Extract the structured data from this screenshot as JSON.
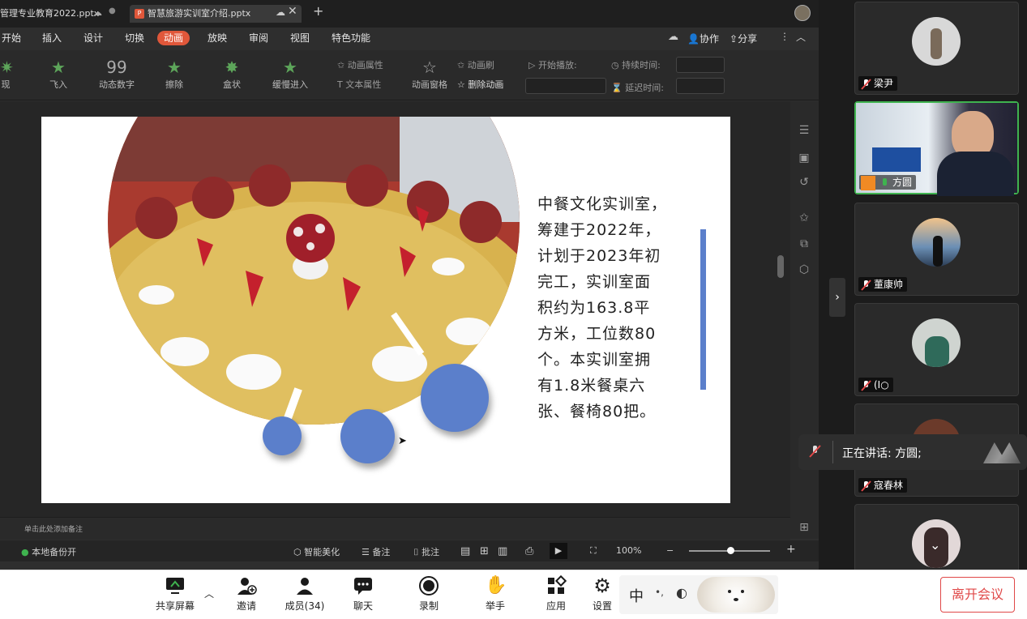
{
  "ppt": {
    "tabs": [
      "管理专业教育2022.pptx",
      "智慧旅游实训室介绍.pptx"
    ],
    "menus": [
      "开始",
      "插入",
      "设计",
      "切换",
      "动画",
      "放映",
      "审阅",
      "视图",
      "特色功能"
    ],
    "active_menu": "动画",
    "top_right": {
      "collab": "协作",
      "share": "分享"
    },
    "ribbon_effects": [
      "现",
      "飞入",
      "动态数字",
      "擦除",
      "盒状",
      "缓慢进入"
    ],
    "ribbon_small": {
      "anim_props": "动画属性",
      "text_props": "文本属性",
      "anim_pane": "动画窗格",
      "anim_brush": "动画刷",
      "delete_anim": "删除动画",
      "start_play": "开始播放:",
      "duration": "持续时间:",
      "delay": "延迟时间:"
    },
    "slide": {
      "text": "中餐文化实训室，筹建于2022年，计划于2023年初完工，实训室面积约为163.8平方米，工位数80个。本实训室拥有1.8米餐桌六张、餐椅80把。",
      "lines": [
        "中餐文化实训室，",
        "筹建于2022年，",
        "计划于2023年初",
        "完工，实训室面",
        "积约为163.8平",
        "方米，工位数80",
        "个。本实训室拥",
        "有1.8米餐桌六",
        "张、餐椅80把。"
      ],
      "accent_color": "#5b7fcb"
    },
    "notes_placeholder": "单击此处添加备注",
    "status": {
      "backup": "本地备份开",
      "beautify": "智能美化",
      "notes": "备注",
      "comment": "批注",
      "zoom": "100%"
    }
  },
  "meeting": {
    "participants": [
      {
        "name": "梁尹",
        "muted": true
      },
      {
        "name": "方圆",
        "muted": false,
        "speaking": true
      },
      {
        "name": "董康帅",
        "muted": true
      },
      {
        "name": "(I○",
        "muted": true
      },
      {
        "name": "寇春林",
        "muted": true
      },
      {
        "name": "",
        "muted": true
      }
    ],
    "speaking_label": "正在讲话: 方圆;"
  },
  "toolbar": {
    "items": [
      "共享屏幕",
      "邀请",
      "成员(34)",
      "聊天",
      "录制",
      "举手",
      "应用",
      "设置"
    ],
    "leave": "离开会议",
    "ime": "中"
  }
}
